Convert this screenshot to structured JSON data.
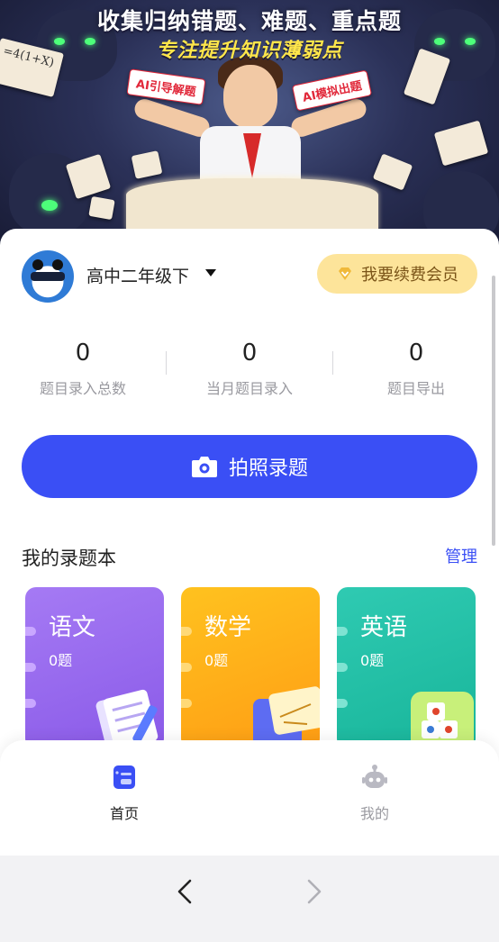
{
  "banner": {
    "title": "收集归纳错题、难题、重点题",
    "subtitle": "专注提升知识薄弱点",
    "tag_left": "AI引导解题",
    "tag_right": "AI模拟出题",
    "formula": "=4(1+X)"
  },
  "user": {
    "grade": "高中二年级下",
    "vip_button": "我要续费会员"
  },
  "stats": [
    {
      "value": "0",
      "label": "题目录入总数"
    },
    {
      "value": "0",
      "label": "当月题目录入"
    },
    {
      "value": "0",
      "label": "题目导出"
    }
  ],
  "photo_button": "拍照录题",
  "notebooks_section": {
    "title": "我的录题本",
    "manage": "管理",
    "items": [
      {
        "subject": "语文",
        "count": "0题",
        "color": "#9b6cf0"
      },
      {
        "subject": "数学",
        "count": "0题",
        "color": "#ffb21c"
      },
      {
        "subject": "英语",
        "count": "0题",
        "color": "#22c2a8"
      }
    ]
  },
  "tabs": [
    {
      "label": "首页",
      "active": true,
      "color": "#222222"
    },
    {
      "label": "我的",
      "active": false,
      "color": "#9a9aa0"
    }
  ],
  "colors": {
    "primary": "#3a4ff5",
    "vip_bg": "#fde49a",
    "vip_text": "#7a5418"
  }
}
